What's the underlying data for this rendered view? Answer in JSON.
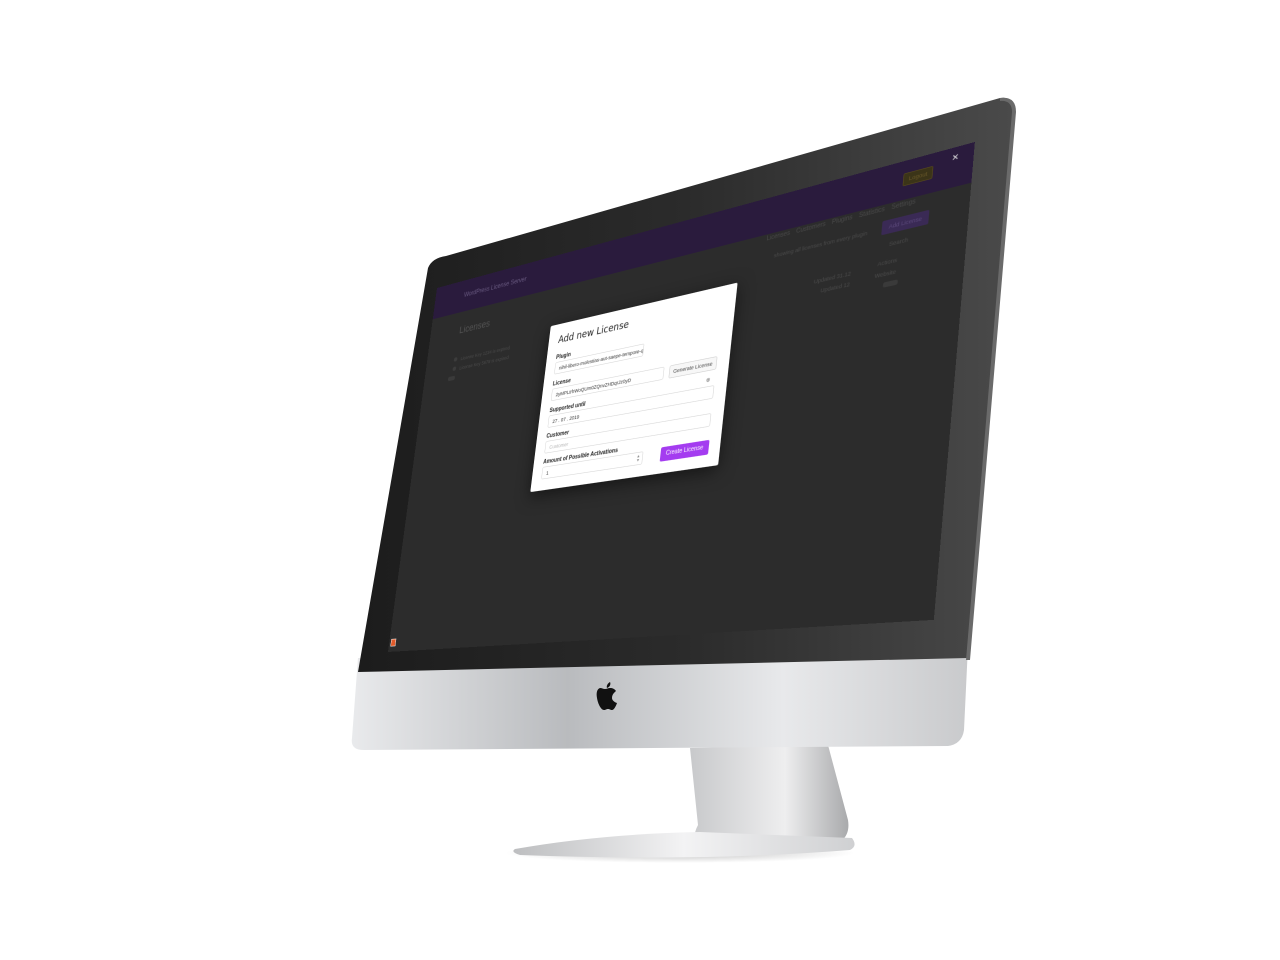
{
  "screen": {
    "overlay_close": "×"
  },
  "background_app": {
    "brand": "WordPress License Server",
    "nav": [
      "Licenses",
      "Customers",
      "Plugins",
      "Statistics",
      "Settings"
    ],
    "login_button": "Logout",
    "page_title": "Licenses",
    "add_button": "Add License",
    "search_label": "Search",
    "list_items": [
      "License Key 1234 is expired",
      "License Key 5678 is expired"
    ],
    "side_labels": [
      "Updated 31.12",
      "Updated 12"
    ],
    "right_labels": [
      "Actions",
      "Website"
    ],
    "top_right_text": "showing all licenses from every plugin"
  },
  "modal": {
    "title": "Add new License",
    "plugin": {
      "label": "Plugin",
      "value": "nihil-libero-molestias-aut-saepe-tempore-quo"
    },
    "license": {
      "label": "License",
      "value": "2yMPLtrhWoQUm0ZQnvZHDqrJz0yD",
      "generate_label": "Generate License"
    },
    "supported_until": {
      "label": "Supported until",
      "value": "27 . 07 . 2019"
    },
    "customer": {
      "label": "Customer",
      "placeholder": "Customer"
    },
    "activations": {
      "label": "Amount of Possible Activations",
      "value": "1"
    },
    "create_label": "Create License"
  },
  "colors": {
    "accent": "#a43cf0",
    "header": "#2a1b3d",
    "overlay": "#2c2c2c"
  }
}
